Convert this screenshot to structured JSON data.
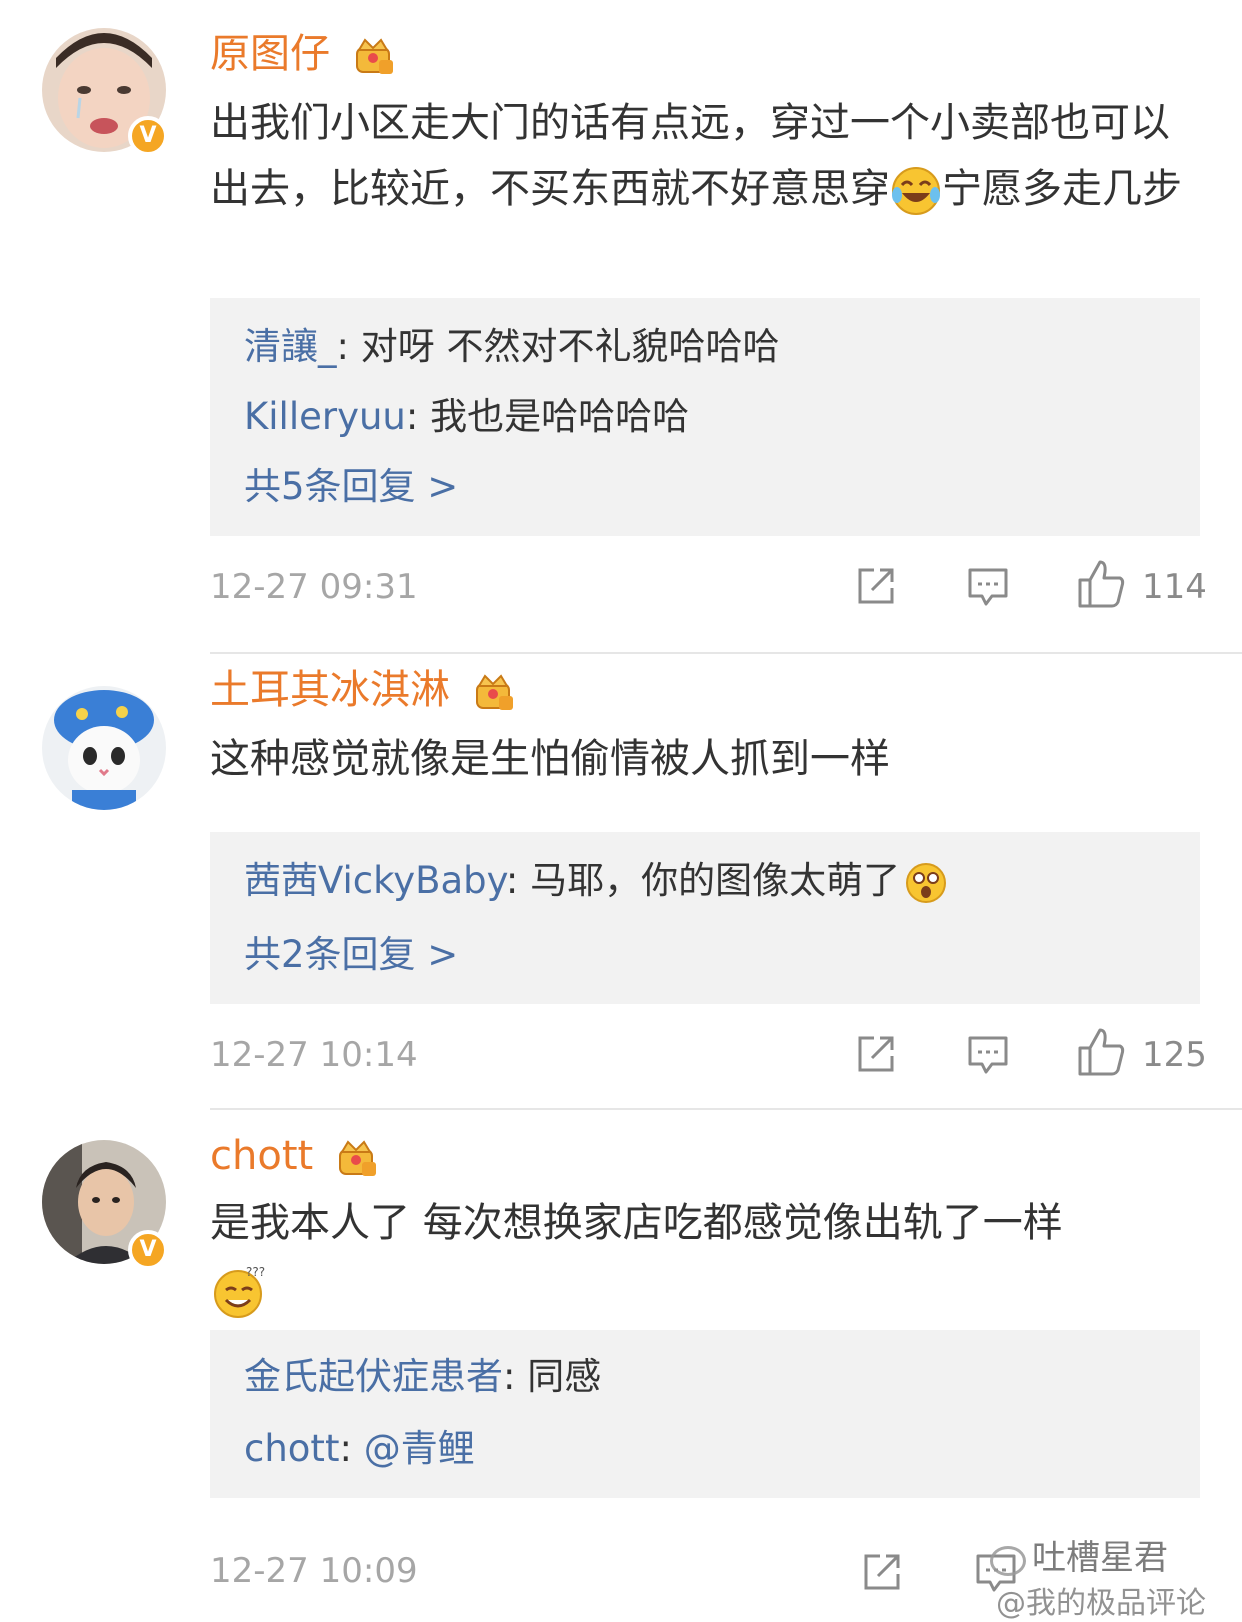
{
  "comments": [
    {
      "username": "原图仔",
      "avatar_icon": "crying-child-avatar",
      "verified": "V",
      "text_a": "出我们小区走大门的话有点远，穿过一个小卖部也可以出去，比较近，不买东西就不好意思穿",
      "text_b": "宁愿多走几步",
      "emoji_icon": "laugh-cry-emoji",
      "replies": [
        {
          "name": "清讓_",
          "sep": ": ",
          "text": "对呀 不然对不礼貌哈哈哈"
        },
        {
          "name": "Killeryuu",
          "sep": ": ",
          "text": "我也是哈哈哈哈"
        }
      ],
      "more": "共5条回复 >",
      "time": "12-27 09:31",
      "likes": "114"
    },
    {
      "username": "土耳其冰淇淋",
      "avatar_icon": "cat-in-blue-hat-avatar",
      "text_a": "这种感觉就像是生怕偷情被人抓到一样",
      "replies": [
        {
          "name": "茜茜VickyBaby",
          "sep": ": ",
          "text": "马耶，你的图像太萌了",
          "emoji_icon": "surprised-emoji"
        }
      ],
      "more": "共2条回复 >",
      "time": "12-27 10:14",
      "likes": "125"
    },
    {
      "username": "chott",
      "avatar_icon": "young-man-avatar",
      "verified": "V",
      "text_a": "是我本人了  每次想换家店吃都感觉像出轨了一样",
      "emoji_icon": "dizzy-smile-emoji",
      "replies": [
        {
          "name": "金氏起伏症患者",
          "sep": ": ",
          "text": "同感"
        },
        {
          "name": "chott",
          "sep": ": ",
          "text": "@青鲤"
        }
      ],
      "time": "12-27 10:09"
    }
  ],
  "watermark": {
    "line1": "吐槽星君",
    "line2": "@我的极品评论"
  },
  "colors": {
    "username": "#ea7a2b",
    "reply_name": "#4a6fa5",
    "reply_bg": "#f2f2f2",
    "timestamp": "#a6a6a6",
    "verified_badge": "#f5a623"
  }
}
